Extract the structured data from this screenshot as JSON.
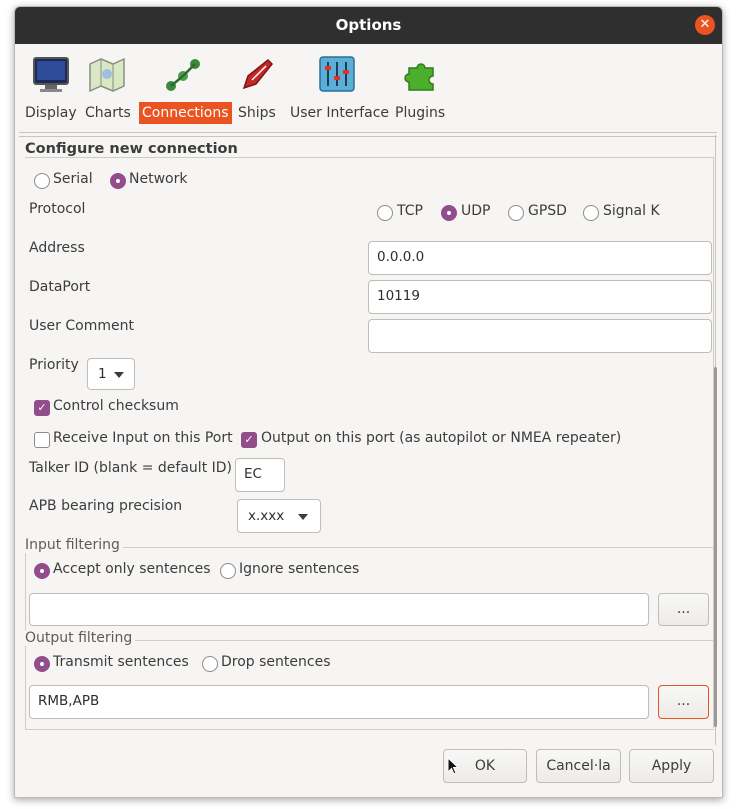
{
  "window": {
    "title": "Options"
  },
  "tabs": [
    {
      "label": "Display",
      "icon": "monitor-icon"
    },
    {
      "label": "Charts",
      "icon": "map-icon"
    },
    {
      "label": "Connections",
      "icon": "connections-icon",
      "active": true
    },
    {
      "label": "Ships",
      "icon": "ship-icon"
    },
    {
      "label": "User Interface",
      "icon": "sliders-icon"
    },
    {
      "label": "Plugins",
      "icon": "puzzle-icon"
    }
  ],
  "connection": {
    "group_title": "Configure new connection",
    "type_serial": "Serial",
    "type_network": "Network",
    "protocol_label": "Protocol",
    "protocols": [
      "TCP",
      "UDP",
      "GPSD",
      "Signal K"
    ],
    "protocol_selected": "UDP",
    "address_label": "Address",
    "address_value": "0.0.0.0",
    "dataport_label": "DataPort",
    "dataport_value": "10119",
    "comment_label": "User Comment",
    "comment_value": "",
    "priority_label": "Priority",
    "priority_value": "1",
    "control_checksum": "Control checksum",
    "receive_input": "Receive Input on this Port",
    "output_port": "Output on this port (as autopilot or NMEA repeater)",
    "talker_label": "Talker ID (blank = default ID)",
    "talker_value": "EC",
    "apb_label": "APB bearing precision",
    "apb_value": "x.xxx"
  },
  "input_filtering": {
    "title": "Input filtering",
    "accept": "Accept only sentences",
    "ignore": "Ignore sentences",
    "value": "",
    "browse": "..."
  },
  "output_filtering": {
    "title": "Output filtering",
    "transmit": "Transmit sentences",
    "drop": "Drop sentences",
    "value": "RMB,APB",
    "browse": "..."
  },
  "buttons": {
    "ok": "OK",
    "cancel": "Cancel·la",
    "apply": "Apply"
  },
  "colors": {
    "accent": "#e95420",
    "check": "#924d8b",
    "titlebar": "#2f2f2f"
  }
}
